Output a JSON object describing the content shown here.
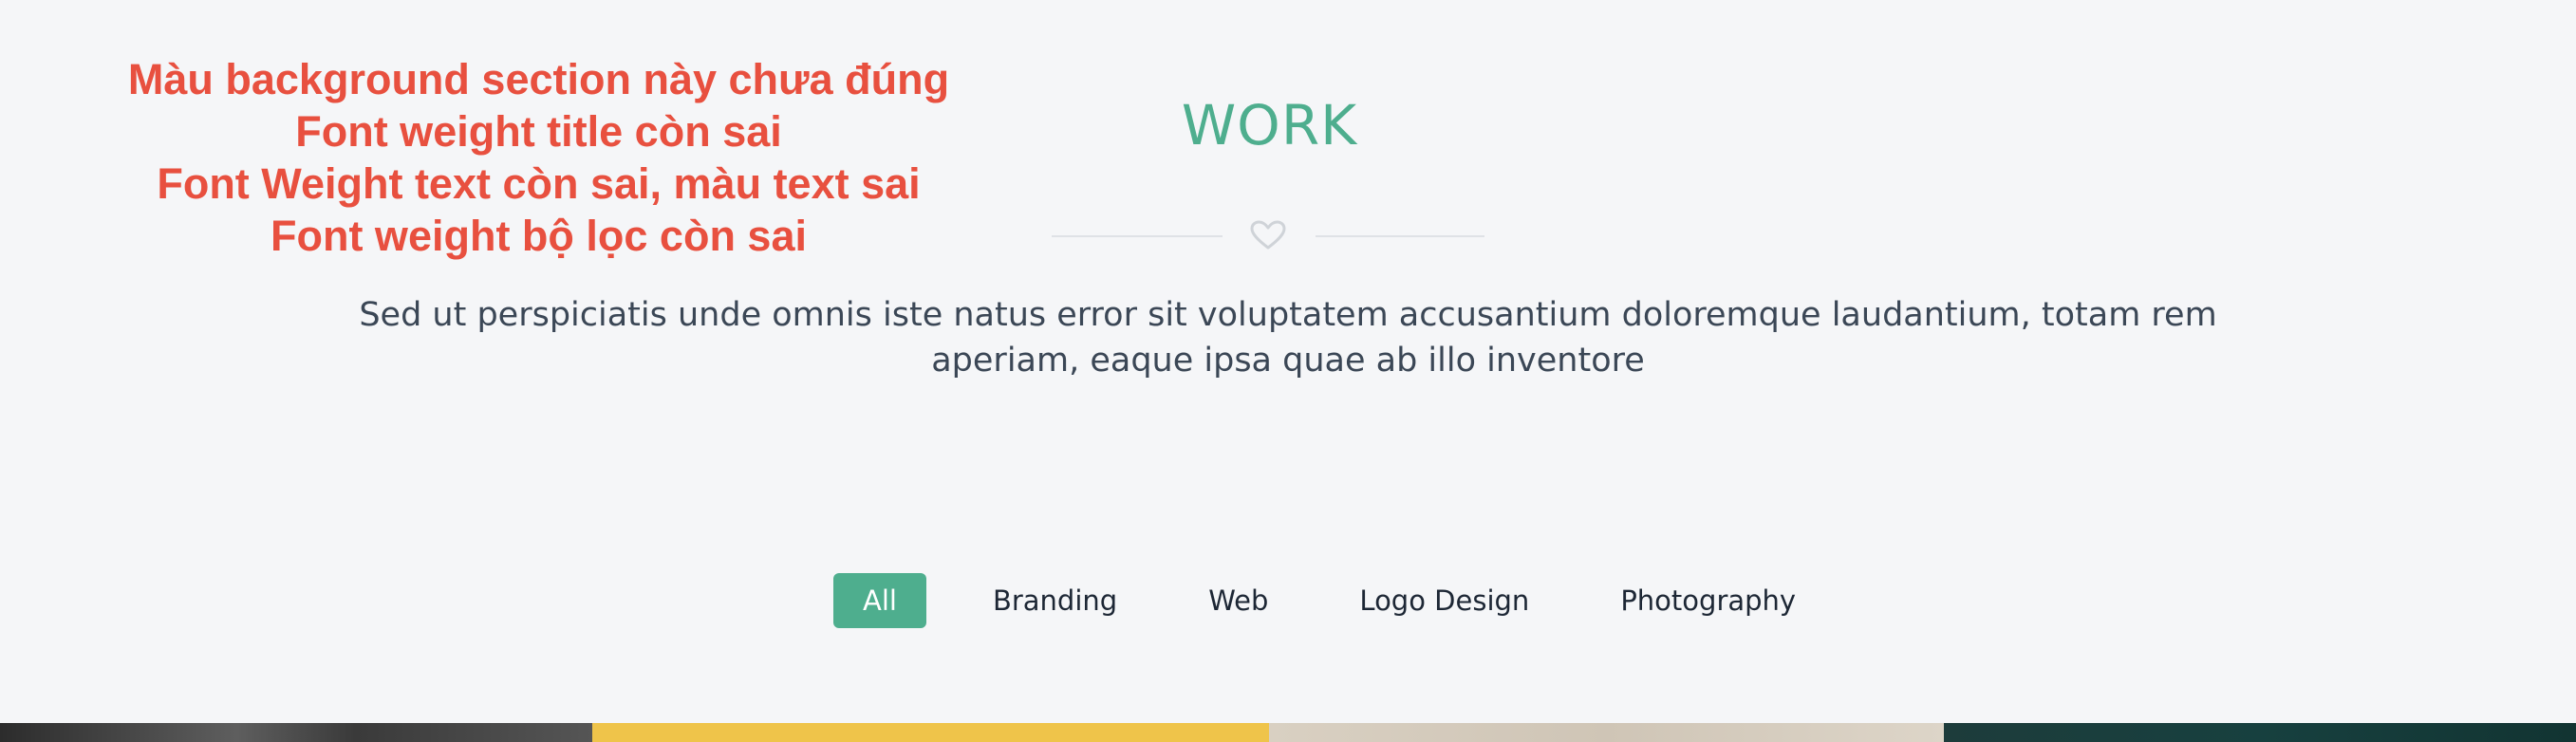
{
  "annotation": {
    "lines": [
      "Màu background section này chưa đúng",
      "Font weight title còn sai",
      "Font Weight text còn sai, màu text sai",
      "Font weight bộ lọc còn sai"
    ]
  },
  "section": {
    "title": "WORK",
    "divider_icon": "heart-icon",
    "description": "Sed ut perspiciatis unde omnis iste natus error sit voluptatem accusantium doloremque laudantium, totam rem aperiam, eaque ipsa quae ab illo inventore"
  },
  "filters": [
    {
      "label": "All",
      "active": true
    },
    {
      "label": "Branding",
      "active": false
    },
    {
      "label": "Web",
      "active": false
    },
    {
      "label": "Logo Design",
      "active": false
    },
    {
      "label": "Photography",
      "active": false
    }
  ],
  "colors": {
    "accent": "#4eae8e",
    "annotation": "#e8503f",
    "background": "#f5f6f8",
    "text": "#3b4756"
  }
}
